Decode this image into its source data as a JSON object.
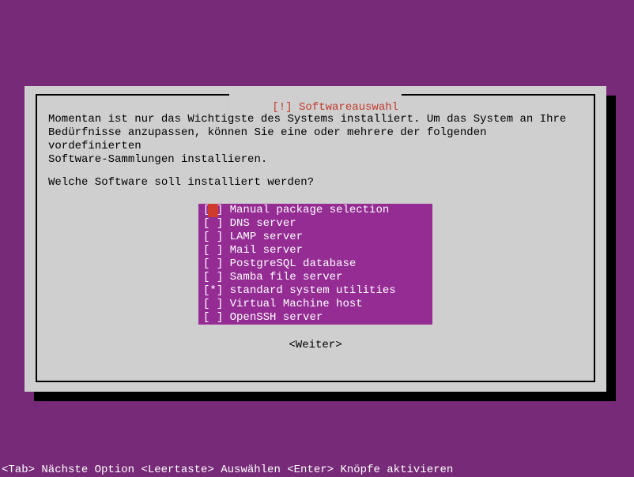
{
  "dialog": {
    "title_prefix": "[!]",
    "title": "Softwareauswahl",
    "description": "Momentan ist nur das Wichtigste des Systems installiert. Um das System an Ihre\nBedürfnisse anzupassen, können Sie eine oder mehrere der folgenden vordefinierten\nSoftware-Sammlungen installieren.",
    "question": "Welche Software soll installiert werden?",
    "options": [
      {
        "mark": " ",
        "label": "Manual package selection",
        "cursor": true
      },
      {
        "mark": " ",
        "label": "DNS server"
      },
      {
        "mark": " ",
        "label": "LAMP server"
      },
      {
        "mark": " ",
        "label": "Mail server"
      },
      {
        "mark": " ",
        "label": "PostgreSQL database"
      },
      {
        "mark": " ",
        "label": "Samba file server"
      },
      {
        "mark": "*",
        "label": "standard system utilities"
      },
      {
        "mark": " ",
        "label": "Virtual Machine host"
      },
      {
        "mark": " ",
        "label": "OpenSSH server"
      }
    ],
    "continue": "<Weiter>"
  },
  "help_bar": "<Tab> Nächste Option <Leertaste> Auswählen <Enter> Knöpfe aktivieren"
}
